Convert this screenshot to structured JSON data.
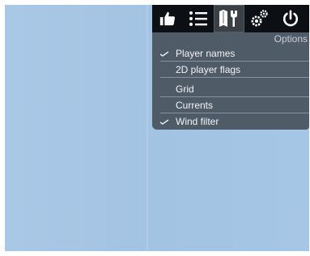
{
  "toolbar": {
    "buttons": [
      {
        "icon": "thumbs-up-icon",
        "active": false
      },
      {
        "icon": "list-icon",
        "active": false
      },
      {
        "icon": "map-tools-icon",
        "active": true
      },
      {
        "icon": "gears-icon",
        "active": false
      },
      {
        "icon": "power-icon",
        "active": false
      }
    ]
  },
  "panel": {
    "title": "Options",
    "options": [
      {
        "label": "Player names",
        "checked": true
      },
      {
        "label": "2D player flags",
        "checked": false
      },
      {
        "label": "Grid",
        "checked": false
      },
      {
        "label": "Currents",
        "checked": false
      },
      {
        "label": "Wind filter",
        "checked": true
      }
    ]
  },
  "colors": {
    "water": "#a6c6e5",
    "toolbar": "#0c0f14",
    "panel": "#444c56",
    "text": "#f2f4f6"
  }
}
